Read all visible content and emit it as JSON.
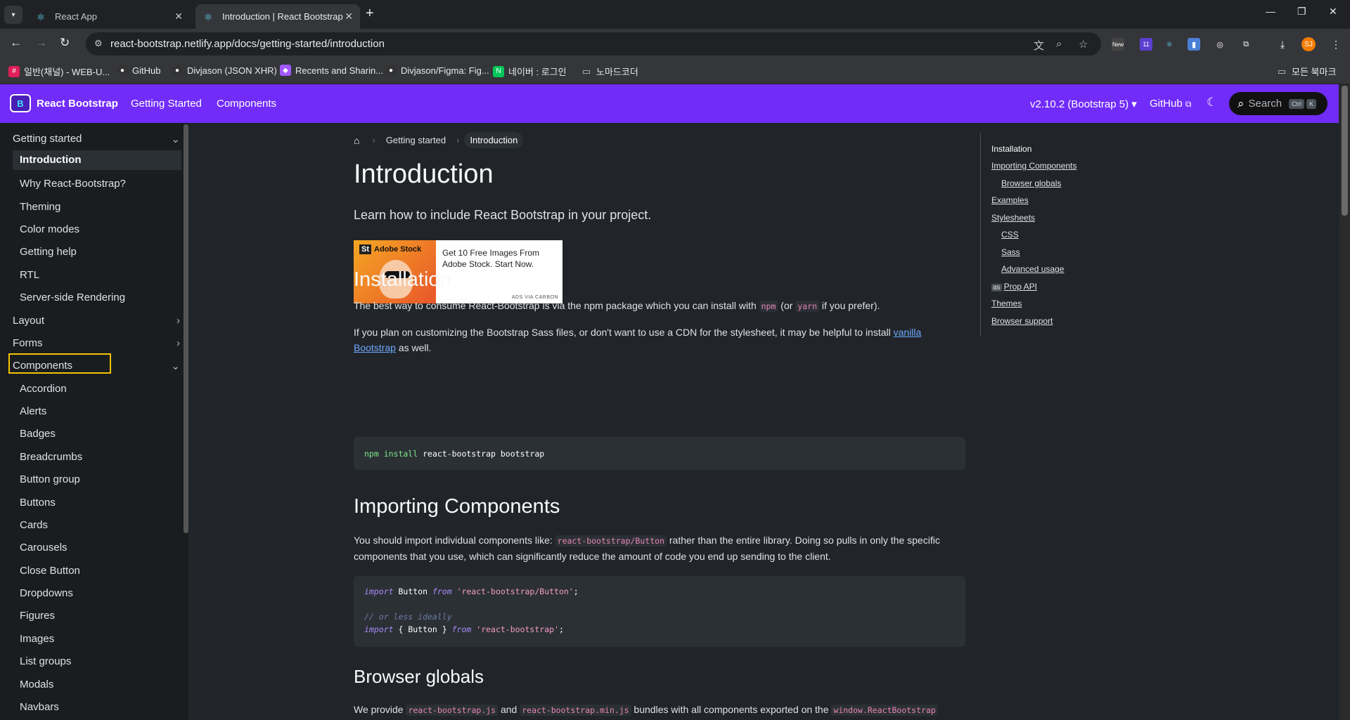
{
  "browser": {
    "tabs": [
      {
        "title": "React App",
        "active": false
      },
      {
        "title": "Introduction | React Bootstrap",
        "active": true
      }
    ],
    "url": "react-bootstrap.netlify.app/docs/getting-started/introduction",
    "new_badge": "New",
    "ext_count": "11",
    "avatar_initials": "SJ",
    "bookmarks": [
      "일반(채널) - WEB-U...",
      "GitHub",
      "Divjason (JSON XHR)",
      "Recents and Sharin...",
      "Divjason/Figma: Fig...",
      "네이버 : 로그인",
      "노마드코더"
    ],
    "all_bookmarks": "모든 북마크"
  },
  "site": {
    "brand": "React Bootstrap",
    "nav": [
      "Getting Started",
      "Components"
    ],
    "version": "v2.10.2 (Bootstrap 5)",
    "github": "GitHub",
    "search_label": "Search",
    "search_kbd": [
      "Ctrl",
      "K"
    ],
    "accent": "#712cf9"
  },
  "sidebar": {
    "sections": [
      {
        "label": "Getting started",
        "expanded": true
      },
      {
        "label": "Layout",
        "expanded": false
      },
      {
        "label": "Forms",
        "expanded": false
      },
      {
        "label": "Components",
        "expanded": true
      }
    ],
    "getting_started_items": [
      "Introduction",
      "Why React-Bootstrap?",
      "Theming",
      "Color modes",
      "Getting help",
      "RTL",
      "Server-side Rendering"
    ],
    "component_items": [
      "Accordion",
      "Alerts",
      "Badges",
      "Breadcrumbs",
      "Button group",
      "Buttons",
      "Cards",
      "Carousels",
      "Close Button",
      "Dropdowns",
      "Figures",
      "Images",
      "List groups",
      "Modals",
      "Navbars"
    ],
    "active": "Introduction"
  },
  "main": {
    "breadcrumbs": [
      "Getting started",
      "Introduction"
    ],
    "title": "Introduction",
    "lead": "Learn how to include React Bootstrap in your project.",
    "ad": {
      "brand": "Adobe Stock",
      "brand_mark": "St",
      "text": "Get 10 Free Images From Adobe Stock. Start Now.",
      "via": "ADS VIA CARBON"
    },
    "installation": {
      "heading": "Installation",
      "p1_a": "The best way to consume React-Bootstrap is via the npm package which you can install with ",
      "p1_npm": "npm",
      "p1_b": " (or ",
      "p1_yarn": "yarn",
      "p1_c": " if you prefer).",
      "p2_a": "If you plan on customizing the Bootstrap Sass files, or don't want to use a CDN for the stylesheet, it may be helpful to install ",
      "p2_link": "vanilla Bootstrap",
      "p2_b": " as well.",
      "code_cmd": "npm install",
      "code_rest": " react-bootstrap bootstrap"
    },
    "importing": {
      "heading": "Importing Components",
      "p_a": "You should import individual components like: ",
      "p_code": "react-bootstrap/Button",
      "p_b": " rather than the entire library. Doing so pulls in only the specific components that you use, which can significantly reduce the amount of code you end up sending to the client.",
      "code": {
        "import_kw": "import",
        "button": " Button ",
        "from_kw": "from",
        "path1": " 'react-bootstrap/Button'",
        "semi": ";",
        "comment": "// or less ideally",
        "brace": " { Button } ",
        "path2": " 'react-bootstrap'"
      }
    },
    "globals": {
      "heading": "Browser globals",
      "p_a": "We provide ",
      "c1": "react-bootstrap.js",
      "p_b": " and ",
      "c2": "react-bootstrap.min.js",
      "p_c": " bundles with all components exported on the ",
      "c3": "window.ReactBootstrap"
    }
  },
  "toc": {
    "items": [
      {
        "label": "Installation",
        "level": 1,
        "current": true
      },
      {
        "label": "Importing Components",
        "level": 1
      },
      {
        "label": "Browser globals",
        "level": 2
      },
      {
        "label": "Examples",
        "level": 1
      },
      {
        "label": "Stylesheets",
        "level": 1
      },
      {
        "label": "CSS",
        "level": 2
      },
      {
        "label": "Sass",
        "level": 2
      },
      {
        "label": "Advanced usage",
        "level": 2
      },
      {
        "label": "Prop API",
        "level": 1,
        "prefix": "as"
      },
      {
        "label": "Themes",
        "level": 1
      },
      {
        "label": "Browser support",
        "level": 1
      }
    ]
  }
}
